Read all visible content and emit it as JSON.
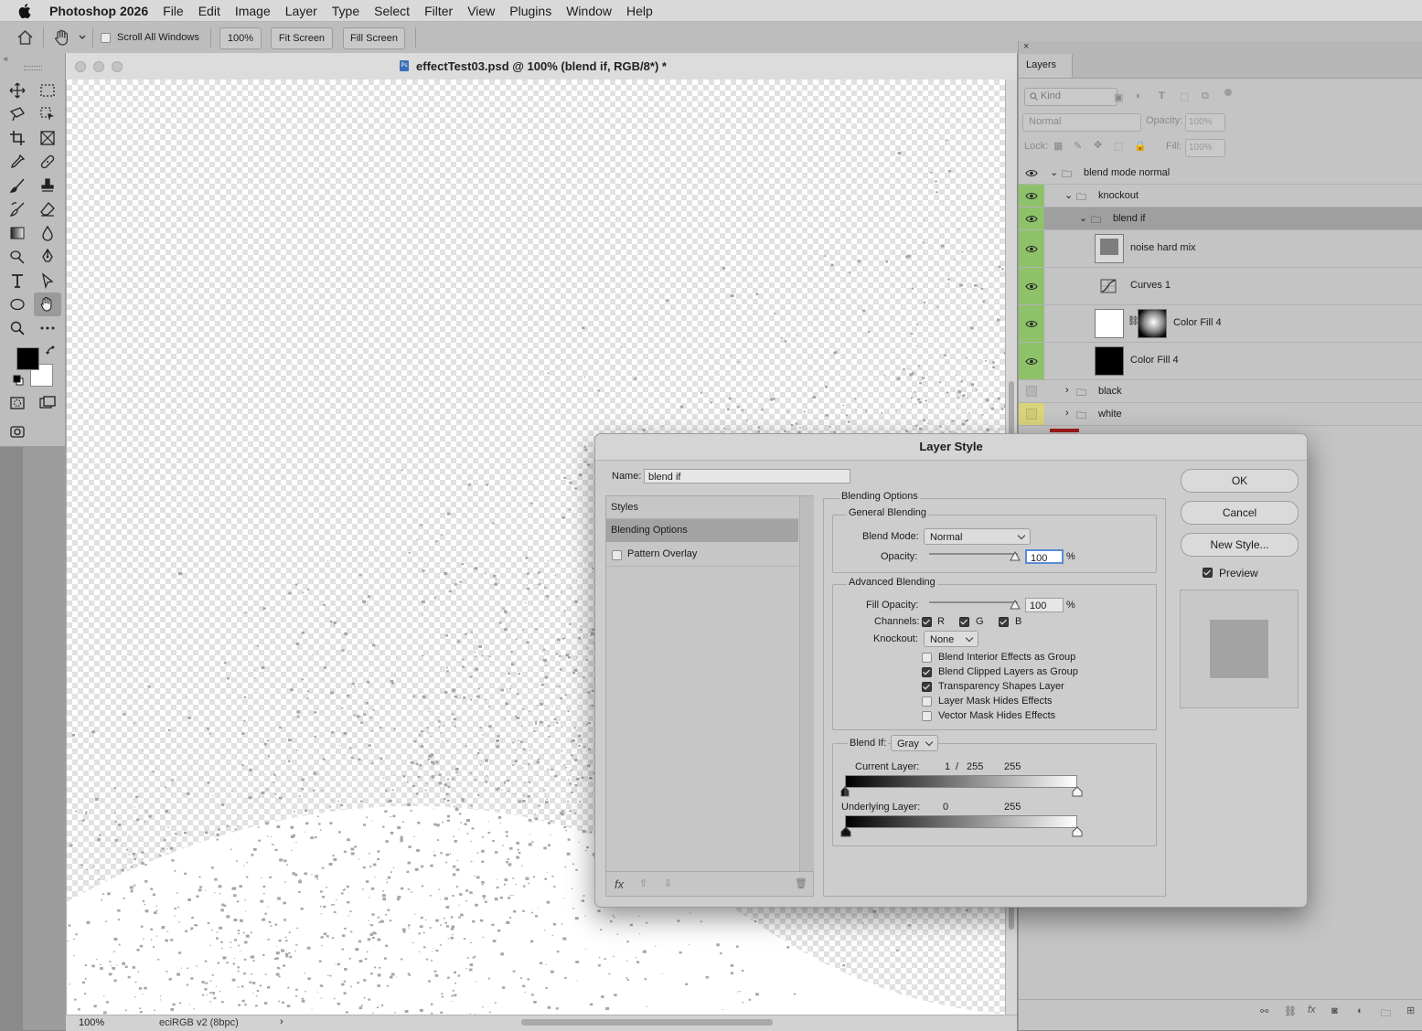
{
  "menubar": {
    "app": "Photoshop 2026",
    "items": [
      "File",
      "Edit",
      "Image",
      "Layer",
      "Type",
      "Select",
      "Filter",
      "View",
      "Plugins",
      "Window",
      "Help"
    ]
  },
  "options": {
    "scroll_all": "Scroll All Windows",
    "zoom_btn": "100%",
    "fit_screen": "Fit Screen",
    "fill_screen": "Fill Screen"
  },
  "document": {
    "title": "effectTest03.psd @ 100% (blend if, RGB/8*) *",
    "zoom": "100%",
    "profile": "eciRGB v2 (8bpc)"
  },
  "layers_panel": {
    "tab": "Layers",
    "kind_filter": "Kind",
    "blend_mode": "Normal",
    "opacity_label": "Opacity:",
    "opacity_value": "100%",
    "lock_label": "Lock:",
    "fill_label": "Fill:",
    "fill_value": "100%",
    "layers": [
      {
        "name": "blend mode normal",
        "type": "group",
        "visible": true
      },
      {
        "name": "knockout",
        "type": "group",
        "visible": true
      },
      {
        "name": "blend if",
        "type": "group",
        "visible": true,
        "selected": true
      },
      {
        "name": "noise hard mix",
        "type": "pixel",
        "visible": true
      },
      {
        "name": "Curves 1",
        "type": "adjustment",
        "visible": true
      },
      {
        "name": "Color Fill 4",
        "type": "fill-with-mask",
        "visible": true
      },
      {
        "name": "Color Fill 4",
        "type": "fill",
        "visible": true
      },
      {
        "name": "black",
        "type": "group",
        "visible": false
      },
      {
        "name": "white",
        "type": "group",
        "visible": false
      }
    ],
    "colors": {
      "eye_column": "#8ec26a",
      "white_row_tag": "#d8d47a",
      "selected_row": "#9f9f9f"
    }
  },
  "dialog": {
    "title": "Layer Style",
    "name_label": "Name:",
    "name_value": "blend if",
    "ok": "OK",
    "cancel": "Cancel",
    "new_style": "New Style...",
    "preview": "Preview",
    "styles_header": "Styles",
    "styles": [
      "Blending Options",
      "Pattern Overlay"
    ],
    "blending_options_title": "Blending Options",
    "general_title": "General Blending",
    "blend_mode_label": "Blend Mode:",
    "blend_mode_value": "Normal",
    "opacity_label": "Opacity:",
    "opacity_value": "100",
    "advanced_title": "Advanced Blending",
    "fill_opacity_label": "Fill Opacity:",
    "fill_opacity_value": "100",
    "percent": "%",
    "channels_label": "Channels:",
    "channels": [
      "R",
      "G",
      "B"
    ],
    "knockout_label": "Knockout:",
    "knockout_value": "None",
    "checkboxes": [
      {
        "label": "Blend Interior Effects as Group",
        "checked": false
      },
      {
        "label": "Blend Clipped Layers as Group",
        "checked": true
      },
      {
        "label": "Transparency Shapes Layer",
        "checked": true
      },
      {
        "label": "Layer Mask Hides Effects",
        "checked": false
      },
      {
        "label": "Vector Mask Hides Effects",
        "checked": false
      }
    ],
    "blend_if_label": "Blend If:",
    "blend_if_value": "Gray",
    "current_layer_label": "Current Layer:",
    "current_layer_low": "1",
    "current_layer_slash": "/",
    "current_layer_mid": "255",
    "current_layer_high": "255",
    "underlying_label": "Underlying Layer:",
    "underlying_low": "0",
    "underlying_high": "255"
  }
}
